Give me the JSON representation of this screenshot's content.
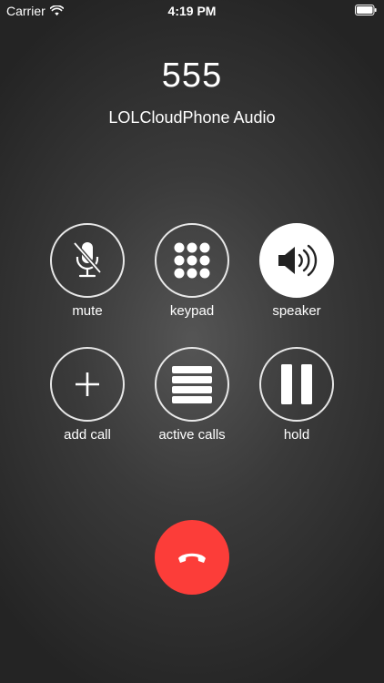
{
  "status_bar": {
    "carrier": "Carrier",
    "time": "4:19 PM",
    "wifi_icon": "wifi-icon",
    "battery_icon": "battery-icon"
  },
  "call": {
    "number": "555",
    "provider": "LOLCloudPhone Audio"
  },
  "controls": {
    "mute": {
      "label": "mute",
      "icon": "microphone-off-icon",
      "active": false
    },
    "keypad": {
      "label": "keypad",
      "icon": "keypad-icon",
      "active": false
    },
    "speaker": {
      "label": "speaker",
      "icon": "speaker-icon",
      "active": true
    },
    "add_call": {
      "label": "add call",
      "icon": "plus-icon",
      "active": false
    },
    "active_calls": {
      "label": "active calls",
      "icon": "list-icon",
      "active": false
    },
    "hold": {
      "label": "hold",
      "icon": "pause-icon",
      "active": false
    }
  },
  "end_call": {
    "icon": "hang-up-icon"
  },
  "colors": {
    "end_call_red": "#fc3d39",
    "foreground": "#ffffff",
    "active_icon": "#222222"
  }
}
